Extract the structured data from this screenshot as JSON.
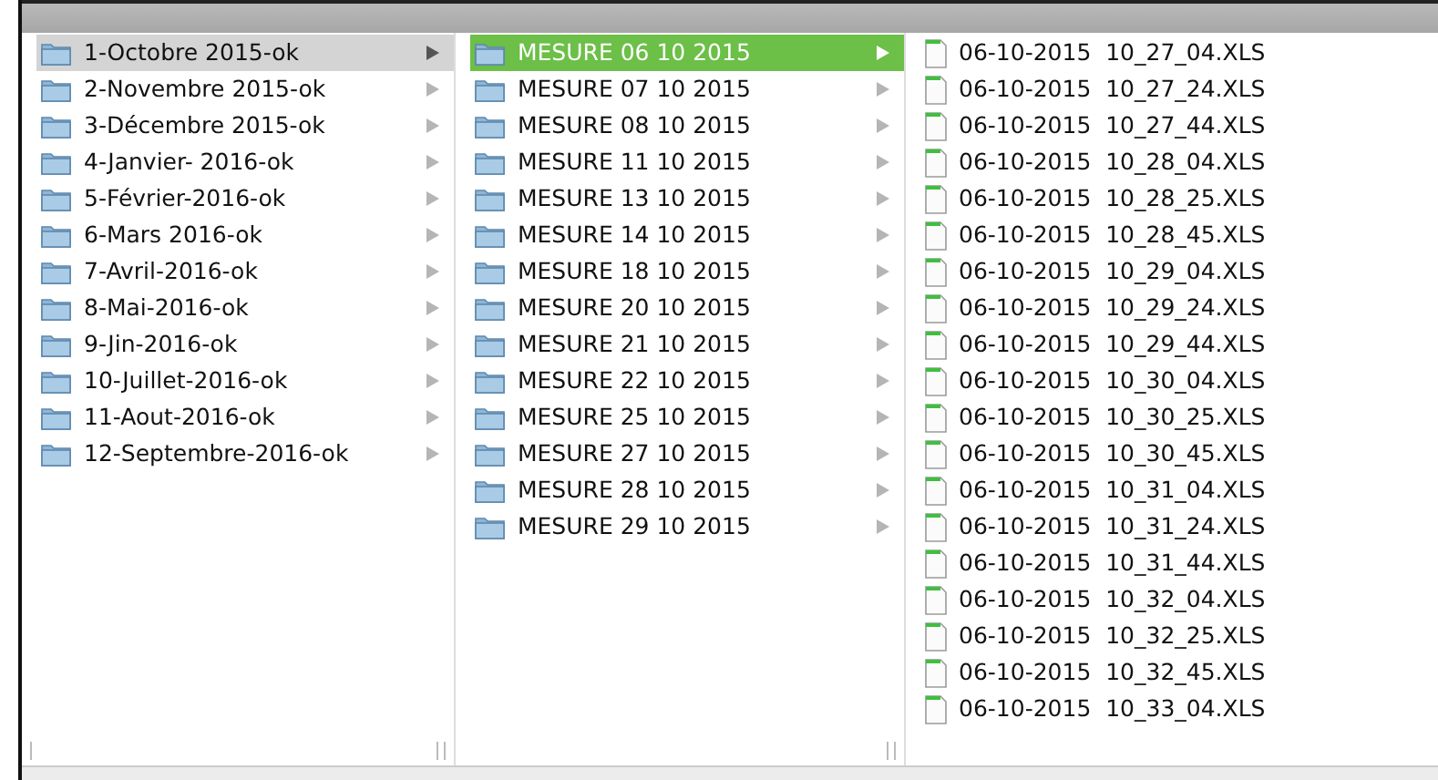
{
  "columns": [
    {
      "focused": false,
      "items": [
        {
          "name": "1-Octobre 2015-ok",
          "selected": true
        },
        {
          "name": "2-Novembre 2015-ok",
          "selected": false
        },
        {
          "name": "3-Décembre 2015-ok",
          "selected": false
        },
        {
          "name": "4-Janvier- 2016-ok",
          "selected": false
        },
        {
          "name": "5-Février-2016-ok",
          "selected": false
        },
        {
          "name": "6-Mars 2016-ok",
          "selected": false
        },
        {
          "name": "7-Avril-2016-ok",
          "selected": false
        },
        {
          "name": "8-Mai-2016-ok",
          "selected": false
        },
        {
          "name": "9-Jin-2016-ok",
          "selected": false
        },
        {
          "name": "10-Juillet-2016-ok",
          "selected": false
        },
        {
          "name": "11-Aout-2016-ok",
          "selected": false
        },
        {
          "name": "12-Septembre-2016-ok",
          "selected": false
        }
      ]
    },
    {
      "focused": true,
      "items": [
        {
          "name": "MESURE 06 10 2015",
          "selected": true
        },
        {
          "name": "MESURE 07 10 2015",
          "selected": false
        },
        {
          "name": "MESURE 08 10 2015",
          "selected": false
        },
        {
          "name": "MESURE 11 10 2015",
          "selected": false
        },
        {
          "name": "MESURE 13 10 2015",
          "selected": false
        },
        {
          "name": "MESURE 14 10 2015",
          "selected": false
        },
        {
          "name": "MESURE 18 10 2015",
          "selected": false
        },
        {
          "name": "MESURE 20 10 2015",
          "selected": false
        },
        {
          "name": "MESURE 21 10 2015",
          "selected": false
        },
        {
          "name": "MESURE 22 10 2015",
          "selected": false
        },
        {
          "name": "MESURE 25 10 2015",
          "selected": false
        },
        {
          "name": "MESURE 27 10 2015",
          "selected": false
        },
        {
          "name": "MESURE 28 10 2015",
          "selected": false
        },
        {
          "name": "MESURE 29 10 2015",
          "selected": false
        }
      ]
    }
  ],
  "files": [
    "06-10-2015  10_27_04.XLS",
    "06-10-2015  10_27_24.XLS",
    "06-10-2015  10_27_44.XLS",
    "06-10-2015  10_28_04.XLS",
    "06-10-2015  10_28_25.XLS",
    "06-10-2015  10_28_45.XLS",
    "06-10-2015  10_29_04.XLS",
    "06-10-2015  10_29_24.XLS",
    "06-10-2015  10_29_44.XLS",
    "06-10-2015  10_30_04.XLS",
    "06-10-2015  10_30_25.XLS",
    "06-10-2015  10_30_45.XLS",
    "06-10-2015  10_31_04.XLS",
    "06-10-2015  10_31_24.XLS",
    "06-10-2015  10_31_44.XLS",
    "06-10-2015  10_32_04.XLS",
    "06-10-2015  10_32_25.XLS",
    "06-10-2015  10_32_45.XLS",
    "06-10-2015  10_33_04.XLS"
  ]
}
